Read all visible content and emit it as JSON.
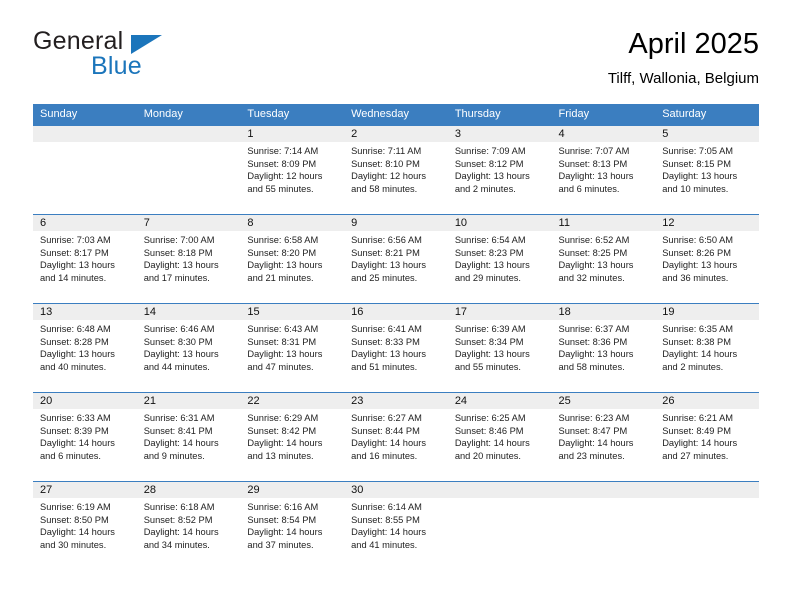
{
  "brand": {
    "name_part1": "General",
    "name_part2": "Blue",
    "logo_icon": "blue-triangle-logo"
  },
  "header": {
    "title": "April 2025",
    "subtitle": "Tilff, Wallonia, Belgium"
  },
  "colors": {
    "header_blue": "#3b7ec0",
    "brand_blue": "#1b75bb",
    "daynum_band": "#eeeeee",
    "row_divider": "#3b7ec0"
  },
  "weekday_headers": [
    "Sunday",
    "Monday",
    "Tuesday",
    "Wednesday",
    "Thursday",
    "Friday",
    "Saturday"
  ],
  "weeks": [
    [
      {
        "day": "",
        "sunrise": "",
        "sunset": "",
        "daylight1": "",
        "daylight2": ""
      },
      {
        "day": "",
        "sunrise": "",
        "sunset": "",
        "daylight1": "",
        "daylight2": ""
      },
      {
        "day": "1",
        "sunrise": "Sunrise: 7:14 AM",
        "sunset": "Sunset: 8:09 PM",
        "daylight1": "Daylight: 12 hours",
        "daylight2": "and 55 minutes."
      },
      {
        "day": "2",
        "sunrise": "Sunrise: 7:11 AM",
        "sunset": "Sunset: 8:10 PM",
        "daylight1": "Daylight: 12 hours",
        "daylight2": "and 58 minutes."
      },
      {
        "day": "3",
        "sunrise": "Sunrise: 7:09 AM",
        "sunset": "Sunset: 8:12 PM",
        "daylight1": "Daylight: 13 hours",
        "daylight2": "and 2 minutes."
      },
      {
        "day": "4",
        "sunrise": "Sunrise: 7:07 AM",
        "sunset": "Sunset: 8:13 PM",
        "daylight1": "Daylight: 13 hours",
        "daylight2": "and 6 minutes."
      },
      {
        "day": "5",
        "sunrise": "Sunrise: 7:05 AM",
        "sunset": "Sunset: 8:15 PM",
        "daylight1": "Daylight: 13 hours",
        "daylight2": "and 10 minutes."
      }
    ],
    [
      {
        "day": "6",
        "sunrise": "Sunrise: 7:03 AM",
        "sunset": "Sunset: 8:17 PM",
        "daylight1": "Daylight: 13 hours",
        "daylight2": "and 14 minutes."
      },
      {
        "day": "7",
        "sunrise": "Sunrise: 7:00 AM",
        "sunset": "Sunset: 8:18 PM",
        "daylight1": "Daylight: 13 hours",
        "daylight2": "and 17 minutes."
      },
      {
        "day": "8",
        "sunrise": "Sunrise: 6:58 AM",
        "sunset": "Sunset: 8:20 PM",
        "daylight1": "Daylight: 13 hours",
        "daylight2": "and 21 minutes."
      },
      {
        "day": "9",
        "sunrise": "Sunrise: 6:56 AM",
        "sunset": "Sunset: 8:21 PM",
        "daylight1": "Daylight: 13 hours",
        "daylight2": "and 25 minutes."
      },
      {
        "day": "10",
        "sunrise": "Sunrise: 6:54 AM",
        "sunset": "Sunset: 8:23 PM",
        "daylight1": "Daylight: 13 hours",
        "daylight2": "and 29 minutes."
      },
      {
        "day": "11",
        "sunrise": "Sunrise: 6:52 AM",
        "sunset": "Sunset: 8:25 PM",
        "daylight1": "Daylight: 13 hours",
        "daylight2": "and 32 minutes."
      },
      {
        "day": "12",
        "sunrise": "Sunrise: 6:50 AM",
        "sunset": "Sunset: 8:26 PM",
        "daylight1": "Daylight: 13 hours",
        "daylight2": "and 36 minutes."
      }
    ],
    [
      {
        "day": "13",
        "sunrise": "Sunrise: 6:48 AM",
        "sunset": "Sunset: 8:28 PM",
        "daylight1": "Daylight: 13 hours",
        "daylight2": "and 40 minutes."
      },
      {
        "day": "14",
        "sunrise": "Sunrise: 6:46 AM",
        "sunset": "Sunset: 8:30 PM",
        "daylight1": "Daylight: 13 hours",
        "daylight2": "and 44 minutes."
      },
      {
        "day": "15",
        "sunrise": "Sunrise: 6:43 AM",
        "sunset": "Sunset: 8:31 PM",
        "daylight1": "Daylight: 13 hours",
        "daylight2": "and 47 minutes."
      },
      {
        "day": "16",
        "sunrise": "Sunrise: 6:41 AM",
        "sunset": "Sunset: 8:33 PM",
        "daylight1": "Daylight: 13 hours",
        "daylight2": "and 51 minutes."
      },
      {
        "day": "17",
        "sunrise": "Sunrise: 6:39 AM",
        "sunset": "Sunset: 8:34 PM",
        "daylight1": "Daylight: 13 hours",
        "daylight2": "and 55 minutes."
      },
      {
        "day": "18",
        "sunrise": "Sunrise: 6:37 AM",
        "sunset": "Sunset: 8:36 PM",
        "daylight1": "Daylight: 13 hours",
        "daylight2": "and 58 minutes."
      },
      {
        "day": "19",
        "sunrise": "Sunrise: 6:35 AM",
        "sunset": "Sunset: 8:38 PM",
        "daylight1": "Daylight: 14 hours",
        "daylight2": "and 2 minutes."
      }
    ],
    [
      {
        "day": "20",
        "sunrise": "Sunrise: 6:33 AM",
        "sunset": "Sunset: 8:39 PM",
        "daylight1": "Daylight: 14 hours",
        "daylight2": "and 6 minutes."
      },
      {
        "day": "21",
        "sunrise": "Sunrise: 6:31 AM",
        "sunset": "Sunset: 8:41 PM",
        "daylight1": "Daylight: 14 hours",
        "daylight2": "and 9 minutes."
      },
      {
        "day": "22",
        "sunrise": "Sunrise: 6:29 AM",
        "sunset": "Sunset: 8:42 PM",
        "daylight1": "Daylight: 14 hours",
        "daylight2": "and 13 minutes."
      },
      {
        "day": "23",
        "sunrise": "Sunrise: 6:27 AM",
        "sunset": "Sunset: 8:44 PM",
        "daylight1": "Daylight: 14 hours",
        "daylight2": "and 16 minutes."
      },
      {
        "day": "24",
        "sunrise": "Sunrise: 6:25 AM",
        "sunset": "Sunset: 8:46 PM",
        "daylight1": "Daylight: 14 hours",
        "daylight2": "and 20 minutes."
      },
      {
        "day": "25",
        "sunrise": "Sunrise: 6:23 AM",
        "sunset": "Sunset: 8:47 PM",
        "daylight1": "Daylight: 14 hours",
        "daylight2": "and 23 minutes."
      },
      {
        "day": "26",
        "sunrise": "Sunrise: 6:21 AM",
        "sunset": "Sunset: 8:49 PM",
        "daylight1": "Daylight: 14 hours",
        "daylight2": "and 27 minutes."
      }
    ],
    [
      {
        "day": "27",
        "sunrise": "Sunrise: 6:19 AM",
        "sunset": "Sunset: 8:50 PM",
        "daylight1": "Daylight: 14 hours",
        "daylight2": "and 30 minutes."
      },
      {
        "day": "28",
        "sunrise": "Sunrise: 6:18 AM",
        "sunset": "Sunset: 8:52 PM",
        "daylight1": "Daylight: 14 hours",
        "daylight2": "and 34 minutes."
      },
      {
        "day": "29",
        "sunrise": "Sunrise: 6:16 AM",
        "sunset": "Sunset: 8:54 PM",
        "daylight1": "Daylight: 14 hours",
        "daylight2": "and 37 minutes."
      },
      {
        "day": "30",
        "sunrise": "Sunrise: 6:14 AM",
        "sunset": "Sunset: 8:55 PM",
        "daylight1": "Daylight: 14 hours",
        "daylight2": "and 41 minutes."
      },
      {
        "day": "",
        "sunrise": "",
        "sunset": "",
        "daylight1": "",
        "daylight2": ""
      },
      {
        "day": "",
        "sunrise": "",
        "sunset": "",
        "daylight1": "",
        "daylight2": ""
      },
      {
        "day": "",
        "sunrise": "",
        "sunset": "",
        "daylight1": "",
        "daylight2": ""
      }
    ]
  ]
}
